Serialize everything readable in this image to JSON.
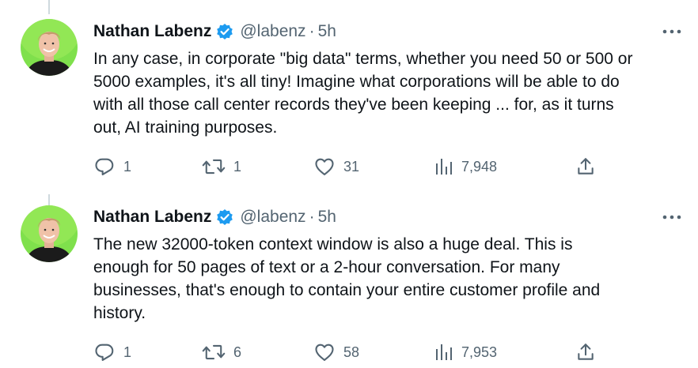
{
  "tweets": [
    {
      "author": {
        "name": "Nathan Labenz",
        "handle": "@labenz"
      },
      "separator": "·",
      "time": "5h",
      "text": "In any case, in corporate \"big data\" terms, whether you need 50 or 500 or\n5000 examples, it's all tiny!  Imagine what corporations will be able to do\nwith all those call center records they've been keeping ... for, as it turns\nout, AI training purposes.",
      "stats": {
        "replies": "1",
        "retweets": "1",
        "likes": "31",
        "views": "7,948"
      }
    },
    {
      "author": {
        "name": "Nathan Labenz",
        "handle": "@labenz"
      },
      "separator": "·",
      "time": "5h",
      "text": "The new 32000-token context window is also a huge deal.  This is\nenough for 50 pages of text or a 2-hour conversation.  For many\nbusinesses, that's enough to contain your entire customer profile and\nhistory.",
      "stats": {
        "replies": "1",
        "retweets": "6",
        "likes": "58",
        "views": "7,953"
      }
    }
  ],
  "icons": {
    "verified": "verified-badge-icon",
    "more": "more-icon",
    "reply": "reply-icon",
    "retweet": "retweet-icon",
    "like": "like-icon",
    "views": "views-icon",
    "share": "share-icon"
  },
  "colors": {
    "text": "#0f1419",
    "secondary": "#536471",
    "verified": "#1d9bf0",
    "thread_line": "#cfd9de",
    "avatar_background": "#7fe04c"
  }
}
